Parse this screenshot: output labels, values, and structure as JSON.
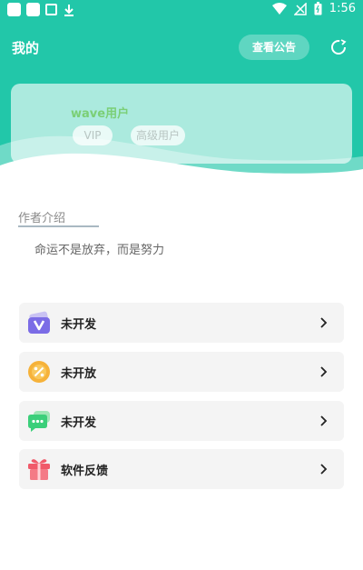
{
  "status_bar": {
    "time": "1:56"
  },
  "header": {
    "title": "我的",
    "notice_button": "查看公告"
  },
  "user": {
    "name": "wave用户",
    "badges": [
      "VIP",
      "高级用户"
    ]
  },
  "author": {
    "label": "作者介绍",
    "motto": "命运不是放弃，而是努力"
  },
  "menu": [
    {
      "label": "未开发",
      "icon": "purple-v-card-icon"
    },
    {
      "label": "未开放",
      "icon": "orange-percent-coin-icon"
    },
    {
      "label": "未开发",
      "icon": "green-chat-bubble-icon"
    },
    {
      "label": "软件反馈",
      "icon": "red-gift-box-icon"
    }
  ],
  "colors": {
    "header_bg": "#22c7a9",
    "username": "#7bcf76",
    "menu_bg": "#f4f4f4"
  }
}
